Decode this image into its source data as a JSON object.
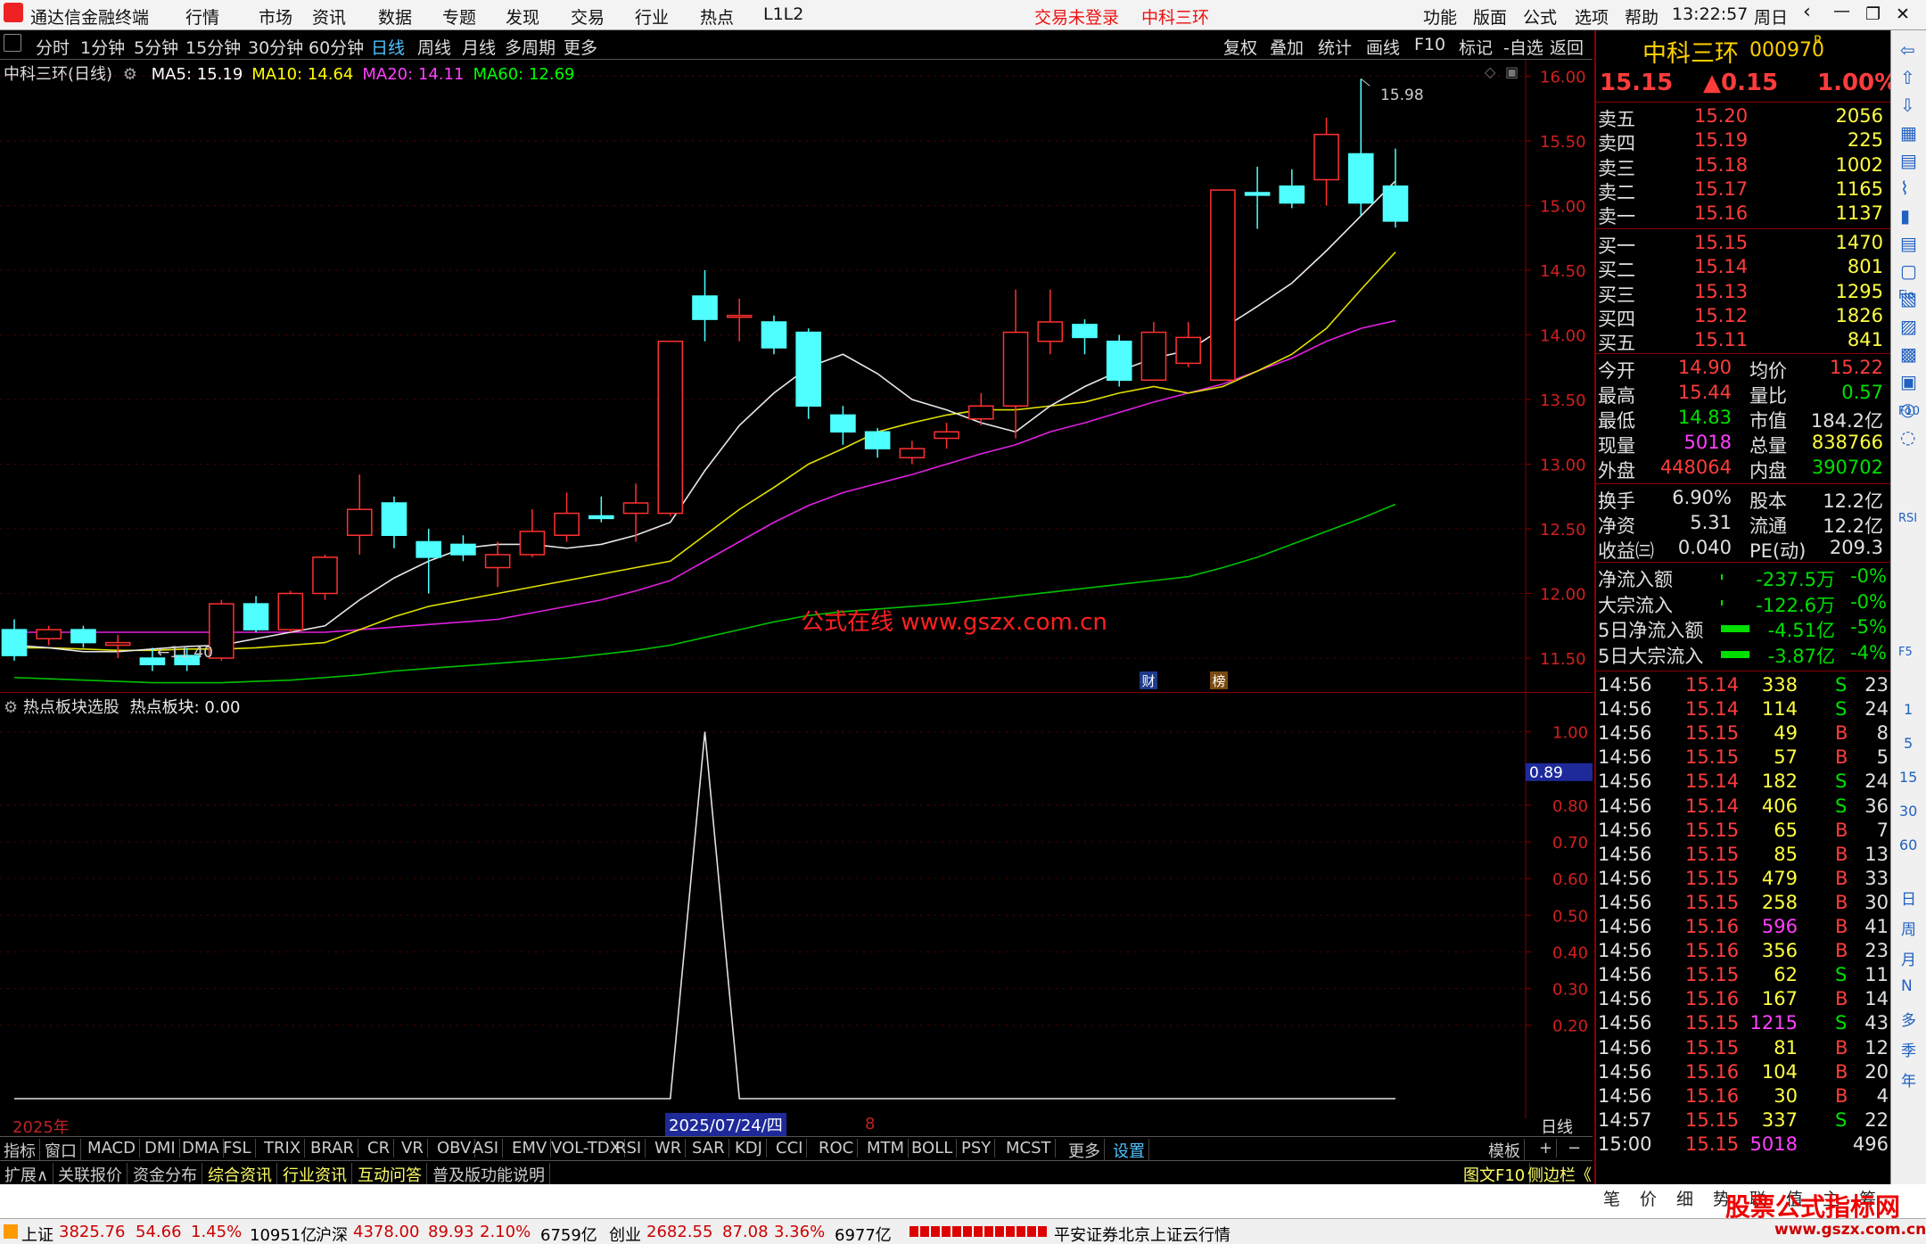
{
  "title_bar": {
    "app": "通达信金融终端",
    "menus": [
      "行情",
      "市场",
      "资讯",
      "数据",
      "专题",
      "发现",
      "交易",
      "行业",
      "热点",
      "L1L2"
    ],
    "notice": "交易未登录",
    "stock": "中科三环",
    "right_menus": [
      "功能",
      "版面",
      "公式",
      "选项",
      "帮助"
    ],
    "time": "13:22:57",
    "weekday": "周日"
  },
  "period_bar": {
    "items": [
      "分时",
      "1分钟",
      "5分钟",
      "15分钟",
      "30分钟",
      "60分钟",
      "日线",
      "周线",
      "月线",
      "多周期",
      "更多"
    ],
    "active": "日线",
    "tools": [
      "复权",
      "叠加",
      "统计",
      "画线",
      "F10",
      "标记",
      "-自选",
      "返回"
    ]
  },
  "main_chart": {
    "name": "中科三环(日线)",
    "ma": [
      {
        "label": "MA5: 15.19",
        "color": "#ffffff"
      },
      {
        "label": "MA10: 14.64",
        "color": "#ffff00"
      },
      {
        "label": "MA20: 14.11",
        "color": "#ff40ff"
      },
      {
        "label": "MA60: 12.69",
        "color": "#00ff00"
      }
    ],
    "watermark": "公式在线   www.gszx.com.cn",
    "high_label": "15.98",
    "low_label": "11.40",
    "badges": [
      "财",
      "榜"
    ],
    "y_ticks": [
      "16.00",
      "15.50",
      "15.00",
      "14.50",
      "14.00",
      "13.50",
      "13.00",
      "12.50",
      "12.00",
      "11.50"
    ]
  },
  "indicator": {
    "name": "热点板块选股",
    "value_label": "热点板块: 0.00",
    "y_ticks": [
      "1.00",
      "0.89",
      "0.80",
      "0.70",
      "0.60",
      "0.50",
      "0.40",
      "0.30",
      "0.20"
    ],
    "current": "0.89"
  },
  "x_axis": {
    "year": "2025年",
    "cursor_date": "2025/07/24/四",
    "mark": "8",
    "period": "日线"
  },
  "indicator_tabs": [
    "指标",
    "窗口",
    "MACD",
    "DMI",
    "DMA",
    "FSL",
    "TRIX",
    "BRAR",
    "CR",
    "VR",
    "OBV",
    "ASI",
    "EMV",
    "VOL-TDX",
    "RSI",
    "WR",
    "SAR",
    "KDJ",
    "CCI",
    "ROC",
    "MTM",
    "BOLL",
    "PSY",
    "MCST",
    "更多",
    "设置"
  ],
  "template_tab": "模板",
  "bottom_tabs": [
    "扩展∧",
    "关联报价",
    "资金分布",
    "综合资讯",
    "行业资讯",
    "互动问答",
    "普及版功能说明"
  ],
  "bottom_right": [
    "图文F10",
    "侧边栏《"
  ],
  "quote_tabs": [
    "笔",
    "价",
    "细",
    "势",
    "联",
    "值",
    "主",
    "筹"
  ],
  "quote": {
    "name": "中科三环",
    "code": "000970",
    "mark": "R",
    "price": "15.15",
    "change": "▲0.15",
    "pct": "1.00%",
    "asks": [
      {
        "label": "卖五",
        "price": "15.20",
        "vol": "2056"
      },
      {
        "label": "卖四",
        "price": "15.19",
        "vol": "225"
      },
      {
        "label": "卖三",
        "price": "15.18",
        "vol": "1002"
      },
      {
        "label": "卖二",
        "price": "15.17",
        "vol": "1165"
      },
      {
        "label": "卖一",
        "price": "15.16",
        "vol": "1137"
      }
    ],
    "bids": [
      {
        "label": "买一",
        "price": "15.15",
        "vol": "1470"
      },
      {
        "label": "买二",
        "price": "15.14",
        "vol": "801"
      },
      {
        "label": "买三",
        "price": "15.13",
        "vol": "1295"
      },
      {
        "label": "买四",
        "price": "15.12",
        "vol": "1826"
      },
      {
        "label": "买五",
        "price": "15.11",
        "vol": "841"
      }
    ],
    "stats": [
      [
        "今开",
        "14.90",
        "均价",
        "15.22"
      ],
      [
        "最高",
        "15.44",
        "量比",
        "0.57"
      ],
      [
        "最低",
        "14.83",
        "市值",
        "184.2亿"
      ],
      [
        "现量",
        "5018",
        "总量",
        "838766"
      ],
      [
        "外盘",
        "448064",
        "内盘",
        "390702"
      ]
    ],
    "stats2": [
      [
        "换手",
        "6.90%",
        "股本",
        "12.2亿"
      ],
      [
        "净资",
        "5.31",
        "流通",
        "12.2亿"
      ],
      [
        "收益㈢",
        "0.040",
        "PE(动)",
        "209.3"
      ]
    ],
    "flows": [
      [
        "净流入额",
        "-237.5万",
        "-0%"
      ],
      [
        "大宗流入",
        "-122.6万",
        "-0%"
      ],
      [
        "5日净流入额",
        "-4.51亿",
        "-5%"
      ],
      [
        "5日大宗流入",
        "-3.87亿",
        "-4%"
      ]
    ],
    "ticks": [
      [
        "14:56",
        "15.14",
        "338",
        "S",
        "23"
      ],
      [
        "14:56",
        "15.14",
        "114",
        "S",
        "24"
      ],
      [
        "14:56",
        "15.15",
        "49",
        "B",
        "8"
      ],
      [
        "14:56",
        "15.15",
        "57",
        "B",
        "5"
      ],
      [
        "14:56",
        "15.14",
        "182",
        "S",
        "24"
      ],
      [
        "14:56",
        "15.14",
        "406",
        "S",
        "36"
      ],
      [
        "14:56",
        "15.15",
        "65",
        "B",
        "7"
      ],
      [
        "14:56",
        "15.15",
        "85",
        "B",
        "13"
      ],
      [
        "14:56",
        "15.15",
        "479",
        "B",
        "33"
      ],
      [
        "14:56",
        "15.15",
        "258",
        "B",
        "30"
      ],
      [
        "14:56",
        "15.16",
        "596",
        "B",
        "41"
      ],
      [
        "14:56",
        "15.16",
        "356",
        "B",
        "23"
      ],
      [
        "14:56",
        "15.15",
        "62",
        "S",
        "11"
      ],
      [
        "14:56",
        "15.16",
        "167",
        "B",
        "14"
      ],
      [
        "14:56",
        "15.15",
        "1215",
        "S",
        "43"
      ],
      [
        "14:56",
        "15.15",
        "81",
        "B",
        "12"
      ],
      [
        "14:56",
        "15.16",
        "104",
        "B",
        "20"
      ],
      [
        "14:56",
        "15.16",
        "30",
        "B",
        "4"
      ],
      [
        "14:57",
        "15.15",
        "337",
        "S",
        "22"
      ],
      [
        "15:00",
        "15.15",
        "5018",
        "",
        "496"
      ]
    ]
  },
  "side_labels": [
    "日",
    "周",
    "月",
    "N",
    "多",
    "季",
    "年"
  ],
  "side_nums": [
    "1",
    "5",
    "15",
    "30",
    "60"
  ],
  "side_text": [
    "Fio",
    "F10",
    "RSI",
    "F5"
  ],
  "status": {
    "sh_label": "上证",
    "sh": "3825.76",
    "sh_chg": "54.66",
    "sh_pct": "1.45%",
    "sh_amt": "10951亿",
    "sz_label": "沪深",
    "sz": "4378.00",
    "sz_chg": "89.93",
    "sz_pct": "2.10%",
    "sz_amt": "6759亿",
    "cy_label": "创业",
    "cy": "2682.55",
    "cy_chg": "87.08",
    "cy_pct": "3.36%",
    "cy_amt": "6977亿",
    "server": "平安证券北京上证云行情"
  },
  "logo": {
    "big": "股票公式指标网",
    "small": "www.gszx.com.cn"
  },
  "chart_data": {
    "type": "candlestick",
    "ylim": [
      11.3,
      16.1
    ],
    "candles": [
      [
        11.72,
        11.52,
        11.8,
        11.48
      ],
      [
        11.65,
        11.72,
        11.75,
        11.6
      ],
      [
        11.72,
        11.62,
        11.75,
        11.58
      ],
      [
        11.6,
        11.62,
        11.68,
        11.5
      ],
      [
        11.5,
        11.45,
        11.58,
        11.4
      ],
      [
        11.52,
        11.45,
        11.58,
        11.4
      ],
      [
        11.5,
        11.92,
        11.95,
        11.48
      ],
      [
        11.92,
        11.72,
        11.98,
        11.7
      ],
      [
        11.72,
        12.0,
        12.02,
        11.7
      ],
      [
        12.0,
        12.28,
        12.3,
        11.95
      ],
      [
        12.45,
        12.65,
        12.92,
        12.3
      ],
      [
        12.7,
        12.45,
        12.75,
        12.35
      ],
      [
        12.4,
        12.28,
        12.5,
        12.0
      ],
      [
        12.38,
        12.3,
        12.45,
        12.25
      ],
      [
        12.2,
        12.3,
        12.4,
        12.05
      ],
      [
        12.3,
        12.48,
        12.65,
        12.28
      ],
      [
        12.45,
        12.62,
        12.78,
        12.4
      ],
      [
        12.6,
        12.58,
        12.75,
        12.55
      ],
      [
        12.62,
        12.7,
        12.85,
        12.4
      ],
      [
        12.62,
        13.95,
        13.95,
        12.6
      ],
      [
        14.3,
        14.12,
        14.5,
        13.95
      ],
      [
        14.15,
        14.15,
        14.28,
        13.95
      ],
      [
        14.1,
        13.9,
        14.15,
        13.85
      ],
      [
        14.02,
        13.45,
        14.05,
        13.35
      ],
      [
        13.38,
        13.25,
        13.45,
        13.15
      ],
      [
        13.25,
        13.12,
        13.28,
        13.05
      ],
      [
        13.05,
        13.12,
        13.18,
        13.0
      ],
      [
        13.2,
        13.25,
        13.32,
        13.12
      ],
      [
        13.35,
        13.45,
        13.55,
        13.3
      ],
      [
        13.45,
        14.02,
        14.35,
        13.2
      ],
      [
        13.95,
        14.1,
        14.35,
        13.85
      ],
      [
        14.08,
        13.98,
        14.12,
        13.85
      ],
      [
        13.95,
        13.65,
        14.0,
        13.6
      ],
      [
        13.65,
        14.02,
        14.1,
        13.65
      ],
      [
        13.78,
        13.98,
        14.1,
        13.75
      ],
      [
        13.65,
        15.12,
        15.12,
        13.65
      ],
      [
        15.1,
        15.08,
        15.3,
        14.82
      ],
      [
        15.15,
        15.02,
        15.28,
        14.98
      ],
      [
        15.2,
        15.55,
        15.68,
        15.0
      ],
      [
        15.4,
        15.02,
        15.98,
        14.92
      ],
      [
        15.15,
        14.88,
        15.44,
        14.83
      ]
    ],
    "ma5": [
      11.6,
      11.58,
      11.55,
      11.55,
      11.57,
      11.59,
      11.6,
      11.65,
      11.7,
      11.75,
      11.95,
      12.12,
      12.25,
      12.35,
      12.38,
      12.38,
      12.35,
      12.38,
      12.45,
      12.55,
      12.95,
      13.3,
      13.55,
      13.75,
      13.85,
      13.7,
      13.5,
      13.42,
      13.32,
      13.25,
      13.45,
      13.6,
      13.72,
      13.82,
      13.88,
      14.05,
      14.22,
      14.4,
      14.65,
      14.92,
      15.19
    ],
    "ma10": [
      11.58,
      11.58,
      11.57,
      11.56,
      11.56,
      11.57,
      11.57,
      11.58,
      11.6,
      11.62,
      11.72,
      11.82,
      11.9,
      11.95,
      12.0,
      12.05,
      12.1,
      12.15,
      12.2,
      12.25,
      12.45,
      12.65,
      12.82,
      13.0,
      13.12,
      13.25,
      13.32,
      13.38,
      13.42,
      13.42,
      13.45,
      13.48,
      13.55,
      13.6,
      13.55,
      13.6,
      13.72,
      13.85,
      14.05,
      14.35,
      14.64
    ],
    "ma20": [
      11.7,
      11.7,
      11.7,
      11.7,
      11.7,
      11.7,
      11.7,
      11.7,
      11.7,
      11.7,
      11.72,
      11.74,
      11.76,
      11.78,
      11.8,
      11.85,
      11.9,
      11.95,
      12.02,
      12.1,
      12.25,
      12.4,
      12.55,
      12.68,
      12.78,
      12.85,
      12.92,
      13.0,
      13.08,
      13.15,
      13.25,
      13.32,
      13.4,
      13.48,
      13.55,
      13.62,
      13.72,
      13.82,
      13.95,
      14.05,
      14.11
    ],
    "ma60": [
      11.35,
      11.34,
      11.33,
      11.32,
      11.31,
      11.31,
      11.31,
      11.32,
      11.33,
      11.35,
      11.37,
      11.4,
      11.42,
      11.44,
      11.46,
      11.48,
      11.5,
      11.53,
      11.56,
      11.6,
      11.66,
      11.72,
      11.78,
      11.83,
      11.86,
      11.88,
      11.9,
      11.92,
      11.95,
      11.98,
      12.01,
      12.04,
      12.07,
      12.1,
      12.13,
      12.2,
      12.28,
      12.38,
      12.48,
      12.58,
      12.69
    ],
    "indicator_values": [
      0,
      0,
      0,
      0,
      0,
      0,
      0,
      0,
      0,
      0,
      0,
      0,
      0,
      0,
      0,
      0,
      0,
      0,
      0,
      0,
      1,
      0,
      0,
      0,
      0,
      0,
      0,
      0,
      0,
      0,
      0,
      0,
      0,
      0,
      0,
      0,
      0,
      0,
      0,
      0,
      0
    ],
    "indicator_ylim": [
      0,
      1
    ]
  }
}
